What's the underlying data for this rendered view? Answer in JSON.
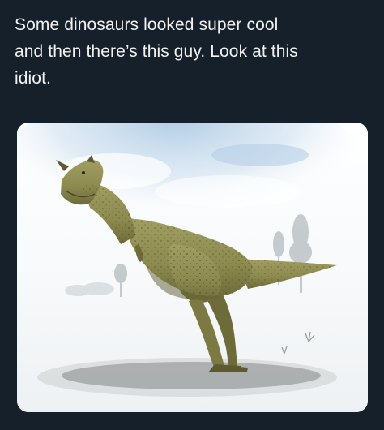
{
  "tweet": {
    "text_lines": [
      "Some dinosaurs looked super cool",
      "and then there’s this guy. Look at this",
      "idiot."
    ]
  },
  "media": {
    "subject": "dinosaur-illustration",
    "colors": {
      "page_background": "#15202b",
      "text": "#f2f2f2",
      "sky_blue": "#a9c7e2",
      "dinosaur_body": "#8c8a4f",
      "dinosaur_shadow": "#5d5a30",
      "ground_shadow": "#8f9091"
    }
  }
}
